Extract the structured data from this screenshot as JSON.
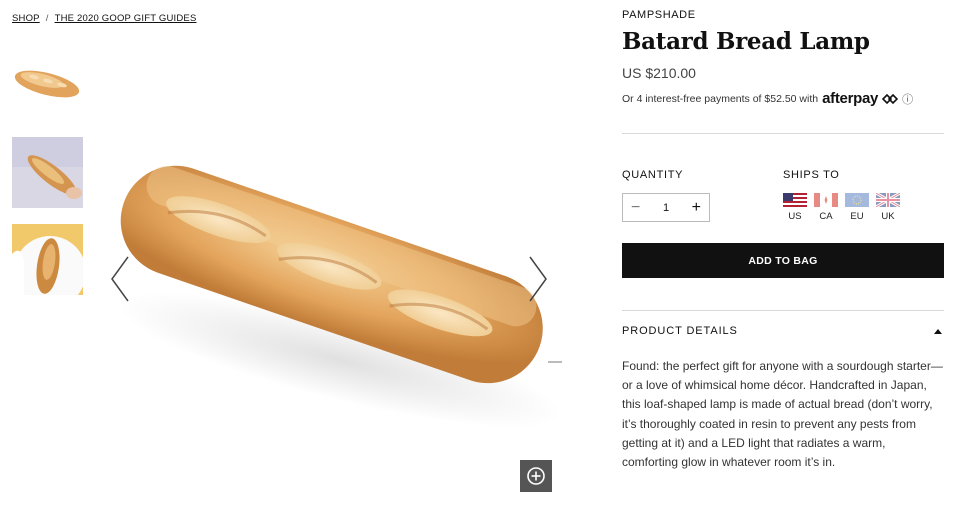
{
  "breadcrumb": {
    "items": [
      {
        "label": "SHOP"
      },
      {
        "label": "THE 2020 GOOP GIFT GUIDES"
      }
    ],
    "separator": "/"
  },
  "gallery": {
    "thumbnails": [
      {
        "name": "bread-lamp-front"
      },
      {
        "name": "bread-lamp-held"
      },
      {
        "name": "bread-lamp-plate"
      }
    ],
    "active_index": 0
  },
  "product": {
    "brand": "PAMPSHADE",
    "title": "Batard Bread Lamp",
    "price": "US $210.00",
    "afterpay_text": "Or 4 interest-free payments of $52.50 with",
    "afterpay_logo": "afterpay",
    "info_icon": "ⓘ"
  },
  "quantity": {
    "label": "QUANTITY",
    "value": "1",
    "minus": "−",
    "plus": "+"
  },
  "ships_to": {
    "label": "SHIPS TO",
    "countries": [
      {
        "code": "US"
      },
      {
        "code": "CA"
      },
      {
        "code": "EU"
      },
      {
        "code": "UK"
      }
    ]
  },
  "add_to_bag": {
    "label": "ADD TO BAG"
  },
  "details": {
    "label": "PRODUCT DETAILS",
    "expanded": true,
    "description": "Found: the perfect gift for anyone with a sourdough starter—or a love of whimsical home décor. Handcrafted in Japan, this loaf-shaped lamp is made of actual bread (don’t worry, it’s thoroughly coated in resin to prevent any pests from getting at it) and a LED light that radiates a warm, comforting glow in whatever room it’s in."
  },
  "icons": {
    "prev": "chevron-left-icon",
    "next": "chevron-right-icon",
    "zoom": "zoom-plus-icon",
    "afterpay": "afterpay-arrows-icon"
  },
  "colors": {
    "bread_light": "#f0c68a",
    "bread_dark": "#c98a3e",
    "button_bg": "#111111",
    "zoom_bg": "#555555"
  }
}
